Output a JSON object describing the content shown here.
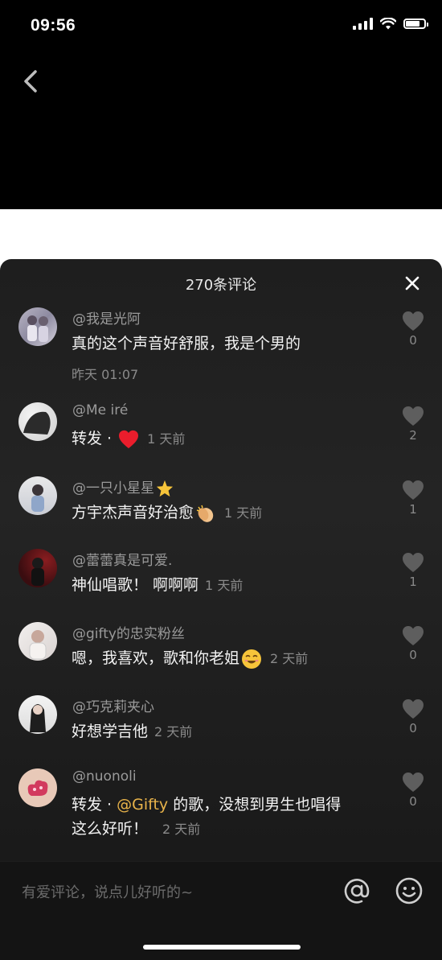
{
  "status_bar": {
    "time": "09:56"
  },
  "sheet": {
    "title": "270条评论"
  },
  "comments": [
    {
      "user": "@我是光阿",
      "text": "真的这个声音好舒服，我是个男的",
      "time": "昨天 01:07",
      "likes": "0"
    },
    {
      "user": "@Me iré",
      "text_prefix": "转发 · ",
      "time": "1 天前",
      "likes": "2"
    },
    {
      "user": "@一只小星星",
      "text": "方宇杰声音好治愈",
      "time": "1 天前",
      "likes": "1"
    },
    {
      "user": "@蕾蕾真是可爱.",
      "text": "神仙唱歌！ 啊啊啊",
      "time": "1 天前",
      "likes": "1"
    },
    {
      "user": "@gifty的忠实粉丝",
      "text": "嗯，我喜欢，歌和你老姐",
      "time": "2 天前",
      "likes": "0"
    },
    {
      "user": "@巧克莉夹心",
      "text": "好想学吉他",
      "time": "2 天前",
      "likes": "0"
    },
    {
      "user": "@nuonoli",
      "text_prefix": "转发 · ",
      "mention": "@Gifty",
      "text_mid": " 的歌，没想到男生也唱得",
      "text_line2": "这么好听！",
      "time": "2 天前",
      "likes": "0"
    }
  ],
  "input": {
    "placeholder": "有爱评论，说点儿好听的~"
  },
  "colors": {
    "mention": "#e8b34a",
    "heart": "#ea1d2c",
    "background": "#000000"
  }
}
